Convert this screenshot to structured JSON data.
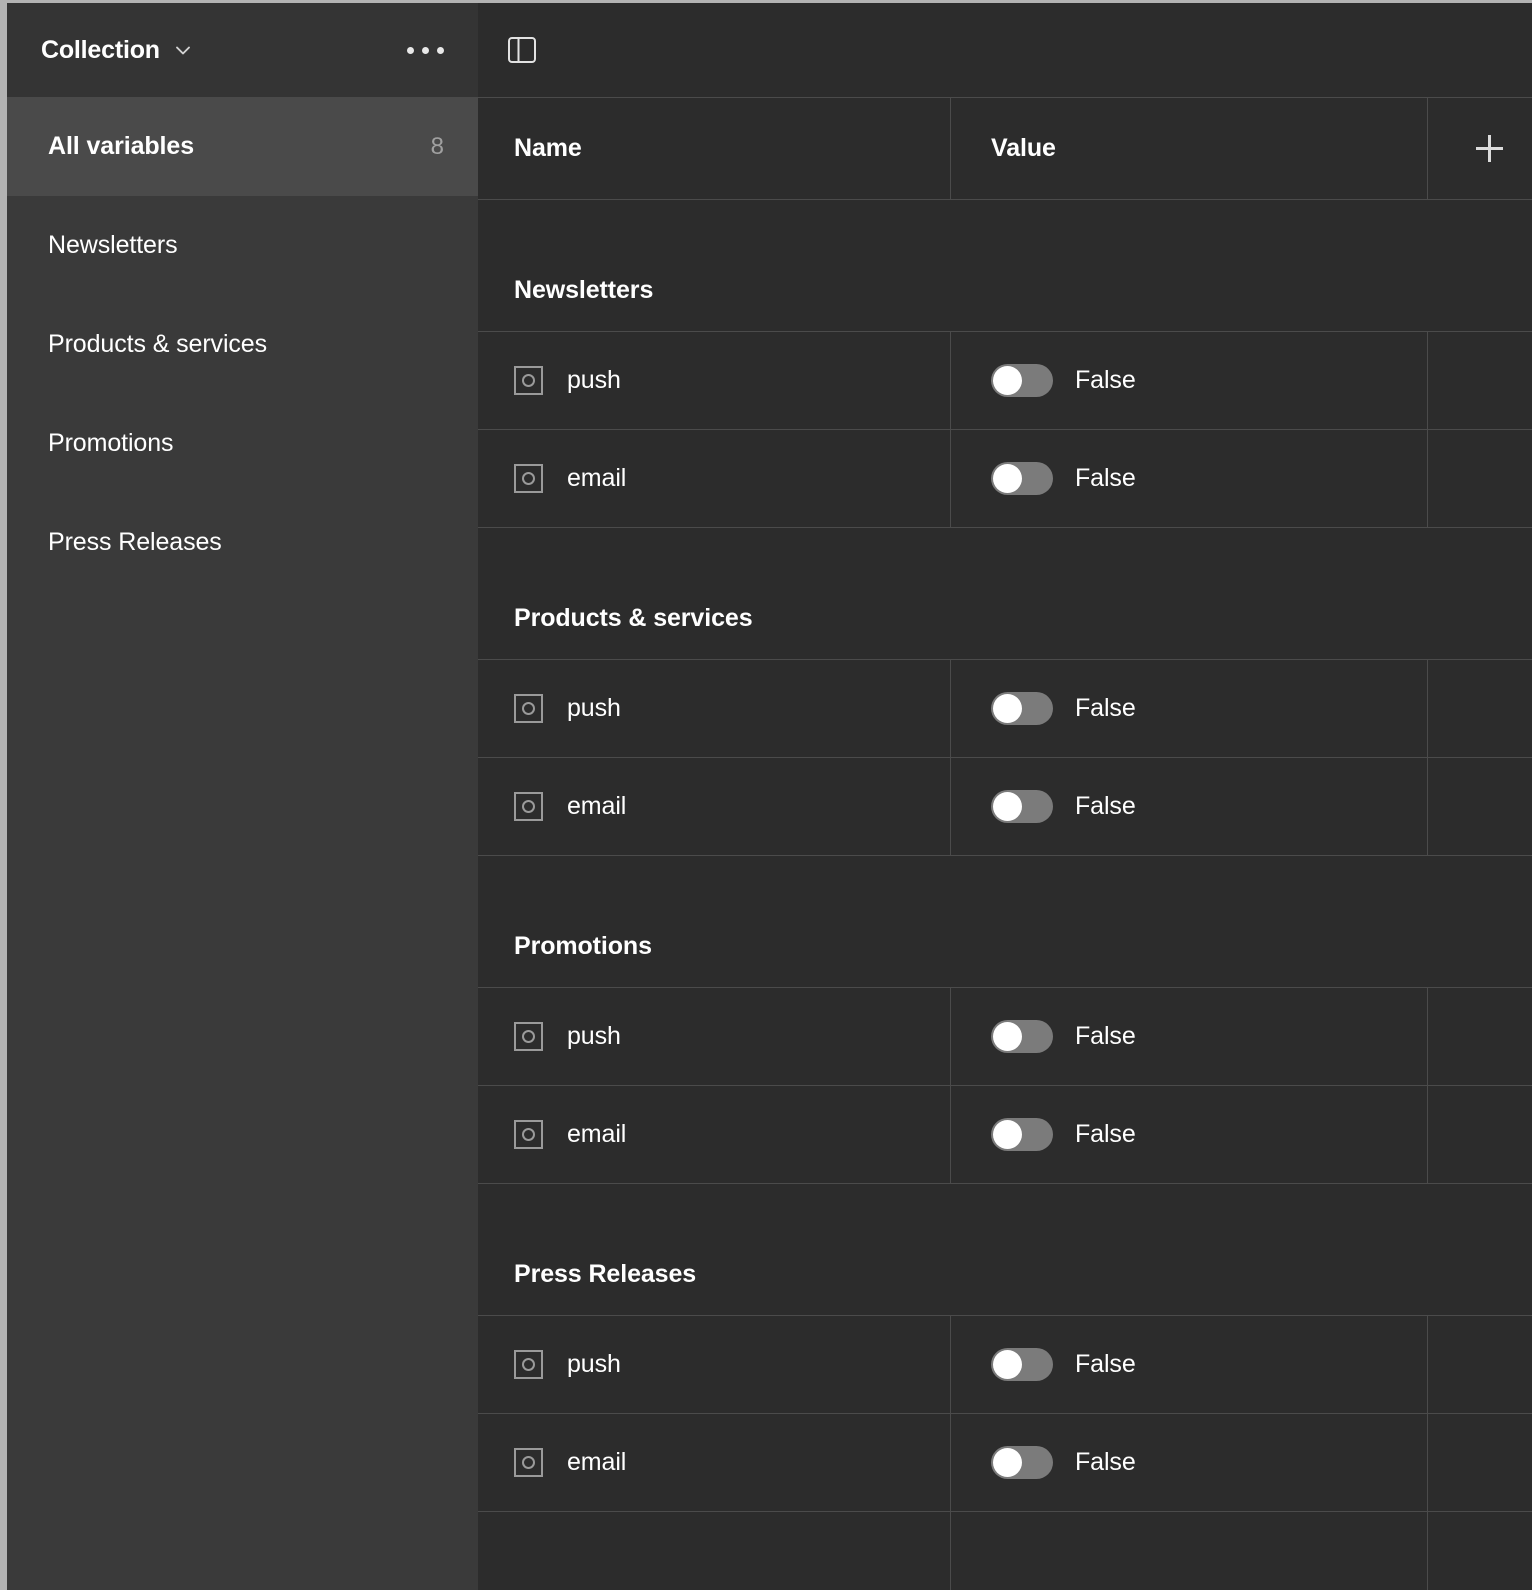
{
  "window": {
    "colors": {
      "sidebar_bg": "#3a3a3a",
      "sidebar_header_bg": "#343434",
      "selected_row_bg": "#4a4a4a",
      "main_bg": "#2c2c2c",
      "divider": "#4b4b4b",
      "toggle_track_off": "#7b7b7b",
      "toggle_knob": "#ffffff",
      "text_primary": "#ffffff",
      "text_muted": "#a0a0a0"
    }
  },
  "sidebar": {
    "header": {
      "title": "Collection",
      "chevron_icon": "chevron-down-icon",
      "menu_icon": "ellipsis-horizontal-icon"
    },
    "items": [
      {
        "label": "All variables",
        "count": "8",
        "selected": true
      },
      {
        "label": "Newsletters",
        "count": "",
        "selected": false
      },
      {
        "label": "Products & services",
        "count": "",
        "selected": false
      },
      {
        "label": "Promotions",
        "count": "",
        "selected": false
      },
      {
        "label": "Press Releases",
        "count": "",
        "selected": false
      }
    ]
  },
  "toolbar": {
    "panel_toggle_icon": "sidebar-panel-toggle-icon"
  },
  "table": {
    "columns": [
      {
        "key": "name",
        "label": "Name"
      },
      {
        "key": "value",
        "label": "Value"
      }
    ],
    "add_mode_icon": "plus-icon",
    "groups": [
      {
        "title": "Newsletters",
        "rows": [
          {
            "type_icon": "boolean-variable-icon",
            "name": "push",
            "toggle_on": false,
            "value_label": "False"
          },
          {
            "type_icon": "boolean-variable-icon",
            "name": "email",
            "toggle_on": false,
            "value_label": "False"
          }
        ]
      },
      {
        "title": "Products & services",
        "rows": [
          {
            "type_icon": "boolean-variable-icon",
            "name": "push",
            "toggle_on": false,
            "value_label": "False"
          },
          {
            "type_icon": "boolean-variable-icon",
            "name": "email",
            "toggle_on": false,
            "value_label": "False"
          }
        ]
      },
      {
        "title": "Promotions",
        "rows": [
          {
            "type_icon": "boolean-variable-icon",
            "name": "push",
            "toggle_on": false,
            "value_label": "False"
          },
          {
            "type_icon": "boolean-variable-icon",
            "name": "email",
            "toggle_on": false,
            "value_label": "False"
          }
        ]
      },
      {
        "title": "Press Releases",
        "rows": [
          {
            "type_icon": "boolean-variable-icon",
            "name": "push",
            "toggle_on": false,
            "value_label": "False"
          },
          {
            "type_icon": "boolean-variable-icon",
            "name": "email",
            "toggle_on": false,
            "value_label": "False"
          }
        ]
      }
    ]
  }
}
